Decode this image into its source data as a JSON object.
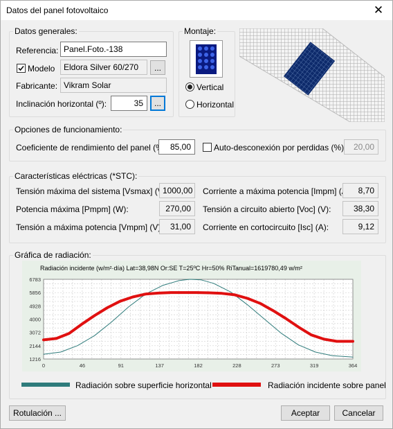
{
  "window": {
    "title": "Datos del panel fotovoltaico",
    "close_glyph": "✕"
  },
  "general": {
    "legend": "Datos generales:",
    "referencia_label": "Referencia:",
    "referencia_value": "Panel.Foto.-138",
    "modelo_label": "Modelo",
    "modelo_checked": true,
    "modelo_value": "Eldora Silver 60/270",
    "fabricante_label": "Fabricante:",
    "fabricante_value": "Vikram Solar",
    "inclinacion_label": "Inclinación horizontal (º):",
    "inclinacion_value": "35",
    "browse_label": "..."
  },
  "montaje": {
    "legend": "Montaje:",
    "vertical_label": "Vertical",
    "horizontal_label": "Horizontal",
    "selected": "Vertical"
  },
  "opciones": {
    "legend": "Opciones de funcionamiento:",
    "coef_label": "Coeficiente de rendimiento del panel (%):",
    "coef_value": "85,00",
    "auto_label": "Auto-desconexión por perdidas (%):",
    "auto_checked": false,
    "auto_value": "20,00"
  },
  "electricas": {
    "legend": "Características eléctricas (*STC):",
    "left": [
      {
        "label": "Tensión máxima del sistema [Vsmax] (V):",
        "value": "1000,00"
      },
      {
        "label": "Potencia máxima [Pmpm] (W):",
        "value": "270,00"
      },
      {
        "label": "Tensión a máxima potencia [Vmpm] (V):",
        "value": "31,00"
      }
    ],
    "right": [
      {
        "label": "Corriente a máxima potencia [Impm] (A):",
        "value": "8,70"
      },
      {
        "label": "Tensión a circuito abierto [Voc] (V):",
        "value": "38,30"
      },
      {
        "label": "Corriente en cortocircuito [Isc] (A):",
        "value": "9,12"
      }
    ]
  },
  "grafica": {
    "legend": "Gráfica de radiación:",
    "legend_horizontal": "Radiación sobre superficie horizontal",
    "legend_panel": "Radiación incidente sobre panel"
  },
  "buttons": {
    "rotulacion": "Rotulación ...",
    "aceptar": "Aceptar",
    "cancelar": "Cancelar"
  },
  "colors": {
    "horizontal": "#2e7b7b",
    "panel": "#e01010",
    "module": "#0d2a6b",
    "plot_bg": "#e8f0e8"
  },
  "chart_data": {
    "type": "line",
    "title": "Radiación incidente (w/m²·día) Lat=38,98N Or:SE T=25ºC Hr=50% RiTanual=1619780,49 w/m²",
    "xlabel": "",
    "ylabel": "",
    "x_ticks": [
      "0",
      "46",
      "91",
      "137",
      "182",
      "228",
      "273",
      "319",
      "364"
    ],
    "y_ticks": [
      "1216",
      "2144",
      "3072",
      "4000",
      "4928",
      "5856",
      "6783"
    ],
    "xlim": [
      0,
      364
    ],
    "ylim": [
      1216,
      6783
    ],
    "grid": true,
    "series": [
      {
        "name": "Radiación sobre superficie horizontal",
        "x": [
          0,
          20,
          40,
          60,
          80,
          100,
          120,
          140,
          160,
          172,
          185,
          200,
          220,
          240,
          260,
          280,
          300,
          320,
          340,
          364
        ],
        "y": [
          1550,
          1700,
          2150,
          2850,
          3800,
          4850,
          5750,
          6350,
          6700,
          6783,
          6750,
          6500,
          5900,
          5000,
          4000,
          3000,
          2200,
          1700,
          1450,
          1350
        ]
      },
      {
        "name": "Radiación incidente sobre panel",
        "x": [
          0,
          15,
          30,
          45,
          60,
          75,
          90,
          105,
          120,
          135,
          150,
          165,
          180,
          195,
          210,
          225,
          240,
          255,
          270,
          285,
          300,
          315,
          330,
          345,
          364
        ],
        "y": [
          2550,
          2650,
          3000,
          3650,
          4250,
          4800,
          5250,
          5550,
          5750,
          5820,
          5856,
          5856,
          5856,
          5840,
          5800,
          5700,
          5450,
          5100,
          4600,
          4050,
          3450,
          2900,
          2600,
          2450,
          2450
        ]
      }
    ]
  }
}
